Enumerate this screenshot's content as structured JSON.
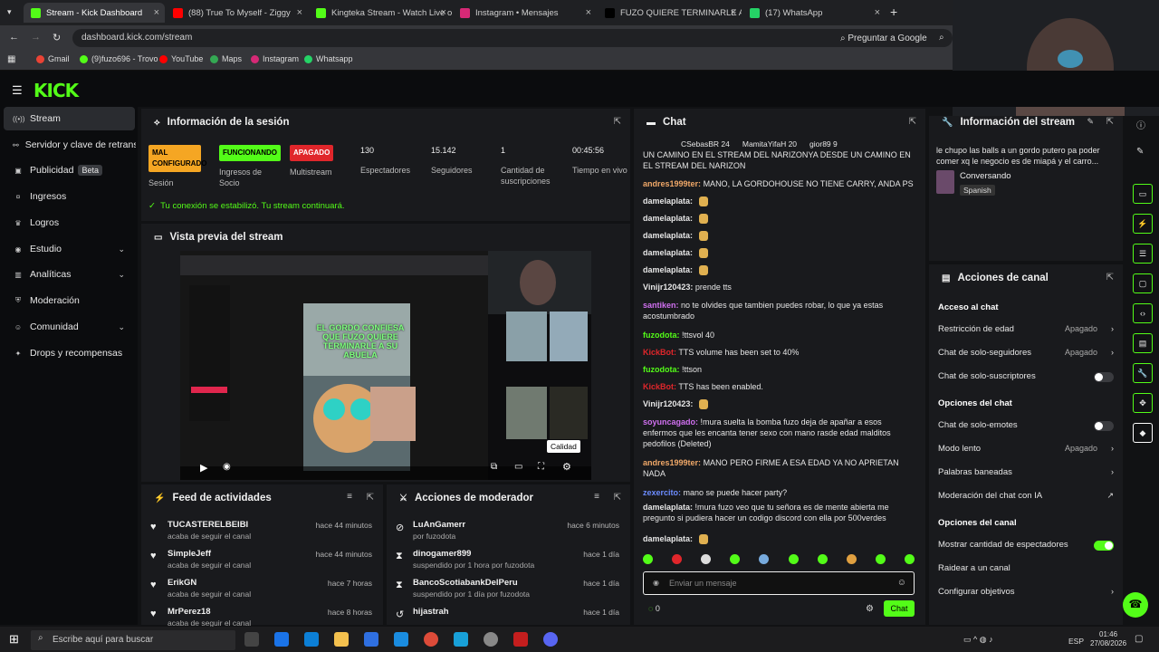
{
  "tabs": [
    {
      "title": "Stream - Kick Dashboard",
      "color": "#53fc18"
    },
    {
      "title": "(88) True To Myself - Ziggy",
      "color": "#ff0000"
    },
    {
      "title": "Kingteka Stream - Watch Live o",
      "color": "#53fc18"
    },
    {
      "title": "Instagram • Mensajes",
      "color": "#d62976"
    },
    {
      "title": "FUZO QUIERE TERMINARLE A LA",
      "color": "#000000"
    },
    {
      "title": "(17) WhatsApp",
      "color": "#25d366"
    }
  ],
  "url": "dashboard.kick.com/stream",
  "url_right": "Preguntar a Google",
  "bookmarks": [
    "Gmail",
    "(9)fuzo696 - Trovo",
    "YouTube",
    "Maps",
    "Instagram",
    "Whatsapp"
  ],
  "logo": "KICK",
  "sidebar": [
    {
      "label": "Stream",
      "icon": "wifi-icon"
    },
    {
      "label": "Servidor y clave de retransmisión",
      "icon": "link-icon"
    },
    {
      "label": "Publicidad",
      "badge": "Beta",
      "icon": "ad-icon"
    },
    {
      "label": "Ingresos",
      "icon": "money-icon"
    },
    {
      "label": "Logros",
      "icon": "trophy-icon"
    },
    {
      "label": "Estudio",
      "icon": "studio-icon"
    },
    {
      "label": "Analíticas",
      "icon": "chart-icon"
    },
    {
      "label": "Moderación",
      "icon": "shield-icon"
    },
    {
      "label": "Comunidad",
      "icon": "users-icon"
    },
    {
      "label": "Drops y recompensas",
      "icon": "gift-icon"
    }
  ],
  "session": {
    "title": "Información de la sesión",
    "stats": [
      {
        "pill": "MAL CONFIGURADO",
        "pill_color": "#f5a623",
        "label": "Sesión"
      },
      {
        "pill": "FUNCIONANDO",
        "pill_color": "#53fc18",
        "label": "Ingresos de Socio"
      },
      {
        "pill": "APAGADO",
        "pill_color": "#e0262b",
        "label": "Multistream"
      },
      {
        "value": "130",
        "label": "Espectadores"
      },
      {
        "value": "15.142",
        "label": "Seguidores"
      },
      {
        "value": "1",
        "label": "Cantidad de suscripciones"
      },
      {
        "value": "00:45:56",
        "label": "Tiempo en vivo"
      }
    ],
    "status": "Tu conexión se estabilizó. Tu stream continuará."
  },
  "preview": {
    "title": "Vista previa del stream",
    "overlay_text": "EL GORDO CONFIESA QUE FUZO QUIERE TERMINARLE A SU ABUELA",
    "quality": "Calidad"
  },
  "feed": {
    "title": "Feed de actividades",
    "items": [
      {
        "name": "TUCASTERELBEIBI",
        "sub": "acaba de seguir el canal",
        "time": "hace 44 minutos"
      },
      {
        "name": "SimpleJeff",
        "sub": "acaba de seguir el canal",
        "time": "hace 44 minutos"
      },
      {
        "name": "ErikGN",
        "sub": "acaba de seguir el canal",
        "time": "hace 7 horas"
      },
      {
        "name": "MrPerez18",
        "sub": "acaba de seguir el canal",
        "time": "hace 8 horas"
      }
    ]
  },
  "modactions": {
    "title": "Acciones de moderador",
    "items": [
      {
        "name": "LuAnGamerr",
        "sub": "por fuzodota",
        "time": "hace 6 minutos",
        "icon": "ban-icon"
      },
      {
        "name": "dinogamer899",
        "sub": "suspendido por 1 hora por fuzodota",
        "time": "hace 1 día",
        "icon": "hourglass-icon"
      },
      {
        "name": "BancoScotiabankDelPeru",
        "sub": "suspendido por 1 día por fuzodota",
        "time": "hace 1 día",
        "icon": "hourglass-icon"
      },
      {
        "name": "hijastrah",
        "sub": "",
        "time": "hace 1 día",
        "icon": "undo-icon"
      }
    ]
  },
  "chat": {
    "title": "Chat",
    "top": [
      "CSebasBR 24",
      "MamitaYifaH 20",
      "gior89 9"
    ],
    "messages": [
      {
        "user": "",
        "color": "#e6e6e6",
        "text": "UN CAMINO EN EL STREAM DEL NARIZONYA DESDE UN CAMINO EN EL STREAM DEL NARIZON"
      },
      {
        "user": "andres1999ter:",
        "color": "#f0a868",
        "text": "MANO, LA GORDOHOUSE NO TIENE CARRY, ANDA PS"
      },
      {
        "user": "damelaplata:",
        "color": "#e6e6e6",
        "text": ""
      },
      {
        "user": "damelaplata:",
        "color": "#e6e6e6",
        "text": ""
      },
      {
        "user": "damelaplata:",
        "color": "#e6e6e6",
        "text": ""
      },
      {
        "user": "damelaplata:",
        "color": "#e6e6e6",
        "text": ""
      },
      {
        "user": "damelaplata:",
        "color": "#e6e6e6",
        "text": ""
      },
      {
        "user": "Vinijr120423:",
        "color": "#e6e6e6",
        "text": "prende tts"
      },
      {
        "user": "santiken:",
        "color": "#d070f0",
        "text": "no te olvides que tambien puedes robar, lo que ya estas acostumbrado"
      },
      {
        "user": "fuzodota:",
        "color": "#53fc18",
        "text": "!ttsvol 40"
      },
      {
        "user": "KickBot:",
        "color": "#e0262b",
        "text": "TTS volume has been set to 40%"
      },
      {
        "user": "fuzodota:",
        "color": "#53fc18",
        "text": "!ttson"
      },
      {
        "user": "KickBot:",
        "color": "#e0262b",
        "text": "TTS has been enabled."
      },
      {
        "user": "Vinijr120423:",
        "color": "#e6e6e6",
        "text": ""
      },
      {
        "user": "soyuncagado:",
        "color": "#d070f0",
        "text": "!mura suelta la bomba fuzo deja de apañar a esos enfermos que les encanta tener sexo con mano rasde edad malditos pedofilos (Deleted)"
      },
      {
        "user": "andres1999ter:",
        "color": "#f0a868",
        "text": "MANO PERO FIRME A ESA EDAD YA NO APRIETAN NADA"
      },
      {
        "user": "zexercito:",
        "color": "#6c8cff",
        "text": "mano se puede hacer party?"
      },
      {
        "user": "damelaplata:",
        "color": "#e6e6e6",
        "text": "!mura fuzo veo que tu señora es de mente abierta me pregunto si pudiera hacer un codigo discord con ella por 500verdes"
      },
      {
        "user": "damelaplata:",
        "color": "#e6e6e6",
        "text": ""
      }
    ],
    "placeholder": "Enviar un mensaje",
    "points": "0",
    "send": "Chat"
  },
  "stream_info": {
    "title": "Información del stream",
    "text": "le chupo las balls a un gordo putero pa poder comer xq le negocio es de miapá y el carro...",
    "category": "Conversando",
    "lang": "Spanish"
  },
  "channel_actions": {
    "title": "Acciones de canal",
    "sections": [
      {
        "header": "Acceso al chat",
        "rows": [
          {
            "label": "Restricción de edad",
            "value": "Apagado",
            "type": "arrow"
          },
          {
            "label": "Chat de solo-seguidores",
            "value": "Apagado",
            "type": "arrow"
          },
          {
            "label": "Chat de solo-suscriptores",
            "type": "toggle",
            "on": false
          }
        ]
      },
      {
        "header": "Opciones del chat",
        "rows": [
          {
            "label": "Chat de solo-emotes",
            "type": "toggle",
            "on": false
          },
          {
            "label": "Modo lento",
            "value": "Apagado",
            "type": "arrow"
          },
          {
            "label": "Palabras baneadas",
            "type": "arrow"
          },
          {
            "label": "Moderación del chat con IA",
            "type": "ext"
          }
        ]
      },
      {
        "header": "Opciones del canal",
        "rows": [
          {
            "label": "Mostrar cantidad de espectadores",
            "type": "toggle",
            "on": true
          },
          {
            "label": "Raidear a un canal",
            "type": "none"
          },
          {
            "label": "Configurar objetivos",
            "type": "arrow"
          }
        ]
      }
    ]
  },
  "taskbar": {
    "search": "Escribe aquí para buscar",
    "time": "01:46",
    "date": "27/08/2026",
    "lang": "ESP"
  }
}
